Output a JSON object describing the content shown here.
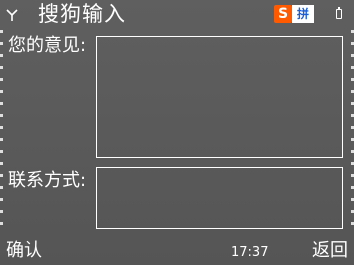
{
  "title_bar": {
    "title": "搜狗输入",
    "ime_logo": "S",
    "ime_mode": "拼",
    "icons": [
      "signal-icon",
      "battery-icon"
    ]
  },
  "form": {
    "opinion_label": "您的意见:",
    "contact_label": "联系方式:",
    "opinion_value": "",
    "contact_value": ""
  },
  "softkeys": {
    "left": "确认",
    "right": "返回",
    "time": "17:37"
  },
  "colors": {
    "background": "#5a5a5a",
    "text": "#ffffff",
    "ime_logo_bg": "#ff5a00",
    "ime_mode_text": "#1a5fd6"
  }
}
